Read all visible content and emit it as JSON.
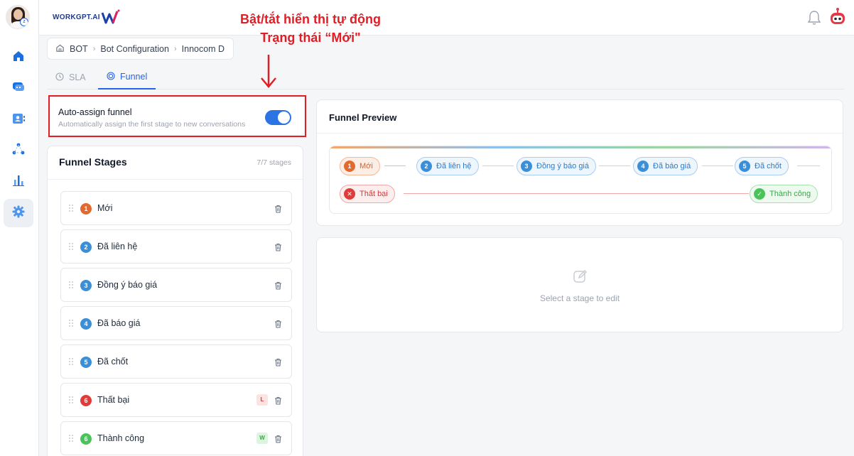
{
  "app": {
    "logo_text": "WORKGPT.AI"
  },
  "breadcrumb": {
    "items": [
      "BOT",
      "Bot Configuration",
      "Innocom D"
    ]
  },
  "tabs": [
    {
      "label": "SLA"
    },
    {
      "label": "Funnel"
    }
  ],
  "annotation": {
    "line1": "Bật/tắt hiển thị tự động",
    "line2": "Trạng thái “Mới\"",
    "color": "#e11d26"
  },
  "auto_assign": {
    "title": "Auto-assign funnel",
    "description": "Automatically assign the first stage to new conversations",
    "enabled": true
  },
  "stages_panel": {
    "title": "Funnel Stages",
    "count": "7/7 stages",
    "stages": [
      {
        "num": "1",
        "name": "Mới",
        "color": "#e36a2e",
        "tag": ""
      },
      {
        "num": "2",
        "name": "Đã liên hệ",
        "color": "#3b8ed8",
        "tag": ""
      },
      {
        "num": "3",
        "name": "Đồng ý báo giá",
        "color": "#3b8ed8",
        "tag": ""
      },
      {
        "num": "4",
        "name": "Đã báo giá",
        "color": "#3b8ed8",
        "tag": ""
      },
      {
        "num": "5",
        "name": "Đã chốt",
        "color": "#3b8ed8",
        "tag": ""
      },
      {
        "num": "6",
        "name": "Thất bại",
        "color": "#e03b3b",
        "tag": "L"
      },
      {
        "num": "6",
        "name": "Thành công",
        "color": "#4cc35a",
        "tag": "W"
      }
    ]
  },
  "preview": {
    "title": "Funnel Preview",
    "pills": [
      {
        "num": "1",
        "name": "Mới"
      },
      {
        "num": "2",
        "name": "Đã liên hệ"
      },
      {
        "num": "3",
        "name": "Đồng ý báo giá"
      },
      {
        "num": "4",
        "name": "Đã báo giá"
      },
      {
        "num": "5",
        "name": "Đã chốt"
      }
    ],
    "fail_label": "Thất bại",
    "success_label": "Thành công"
  },
  "editor": {
    "hint": "Select a stage to edit"
  }
}
